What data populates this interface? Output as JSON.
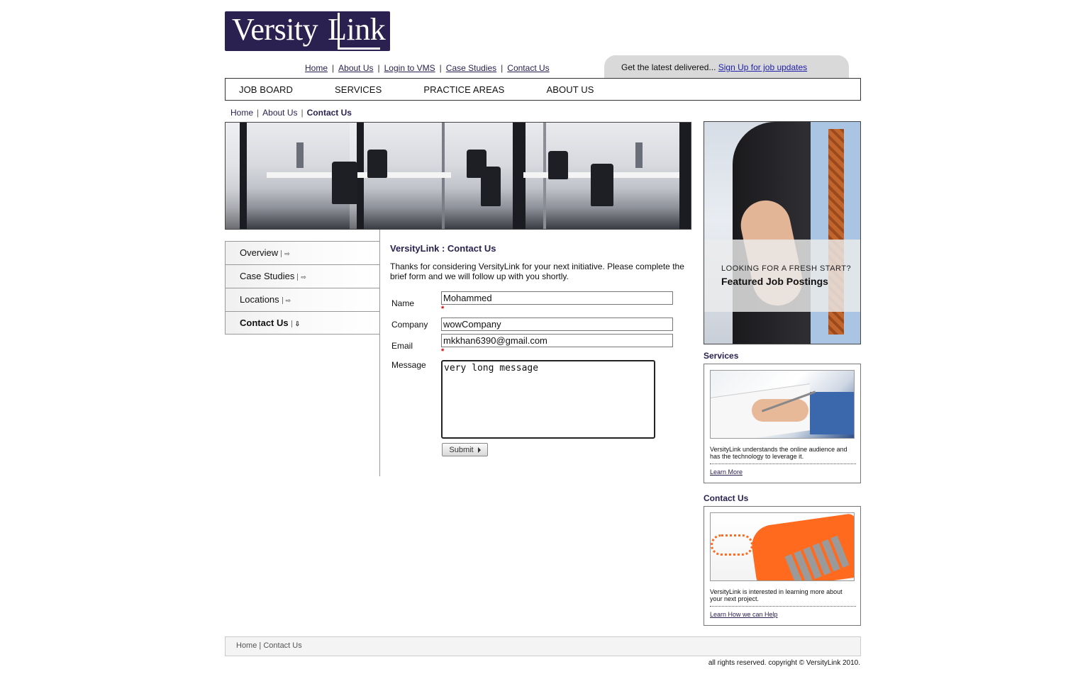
{
  "logo": {
    "text": "Versity",
    "accent": "Link"
  },
  "top_links": [
    "Home",
    "About Us",
    "Login to VMS",
    "Case Studies",
    "Contact Us"
  ],
  "top_links_sep": "|",
  "signup": {
    "text": "Get the latest delivered... ",
    "link": "Sign Up for job updates"
  },
  "main_nav": [
    "JOB BOARD",
    "SERVICES",
    "PRACTICE AREAS",
    "ABOUT US"
  ],
  "breadcrumb": {
    "home": "Home",
    "about": "About Us",
    "current": "Contact Us",
    "sep": "|"
  },
  "side_nav": [
    {
      "label": "Overview",
      "arrow": "⇨"
    },
    {
      "label": "Case Studies",
      "arrow": "⇨"
    },
    {
      "label": "Locations",
      "arrow": "⇨"
    },
    {
      "label": "Contact Us",
      "arrow": "⇩",
      "active": true
    }
  ],
  "content": {
    "title": "VersityLink : Contact Us",
    "intro": "Thanks for considering VersityLink for your next initiative. Please complete the brief form and we will follow up with you shortly."
  },
  "form": {
    "name_label": "Name",
    "name_value": "Mohammed",
    "company_label": "Company",
    "company_value": "wowCompany",
    "email_label": "Email",
    "email_value": "mkkhan6390@gmail.com",
    "message_label": "Message",
    "message_value": "very long message",
    "required_mark": "*",
    "submit_label": "Submit"
  },
  "promo": {
    "line1": "LOOKING FOR A FRESH START?",
    "line2": "Featured Job Postings"
  },
  "services_box": {
    "title": "Services",
    "desc": "VersityLink understands the online audience and has the technology to leverage it.",
    "link": "Learn More"
  },
  "contact_box": {
    "title": "Contact Us",
    "desc": "VersityLink is interested in learning more about your next project.",
    "link": "Learn How we can Help"
  },
  "footer": {
    "home": "Home",
    "sep": "|",
    "contact": "Contact Us"
  },
  "copyright": "all rights reserved. copyright © VersityLink 2010.",
  "colors": {
    "brand": "#2b2150",
    "required": "#dd0000",
    "signup_bg": "#d9d9d9"
  },
  "icons": [
    "arrow-right-icon",
    "arrow-down-icon",
    "submit-arrow-icon"
  ]
}
